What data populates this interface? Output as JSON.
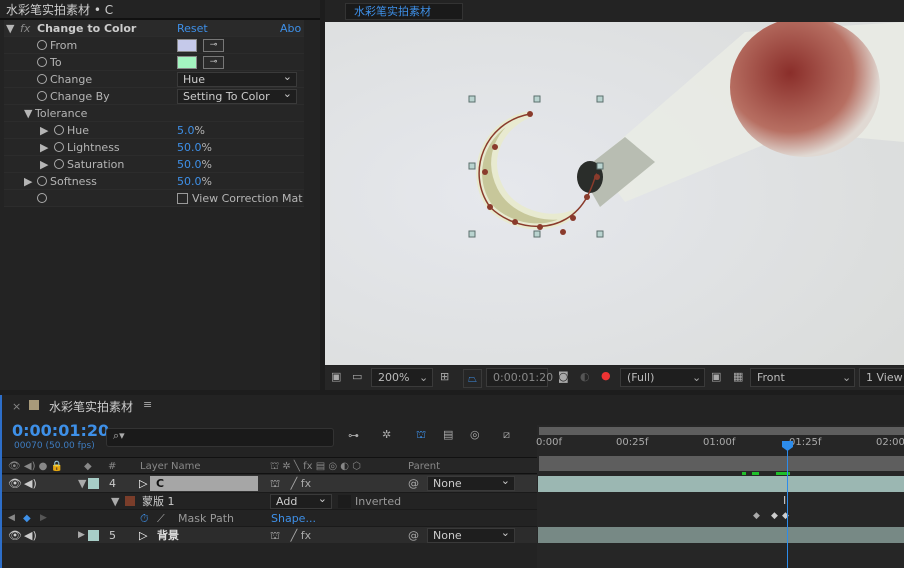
{
  "effects_panel": {
    "title": "水彩笔实拍素材 • C",
    "effect_name": "Change to Color",
    "reset": "Reset",
    "about": "Abo",
    "props": {
      "from": "From",
      "to": "To",
      "change": "Change",
      "change_value": "Hue",
      "change_by": "Change By",
      "change_by_value": "Setting To Color",
      "tolerance": "Tolerance",
      "hue": "Hue",
      "hue_value": "5.0",
      "lightness": "Lightness",
      "lightness_value": "50.0",
      "saturation": "Saturation",
      "saturation_value": "50.0",
      "softness": "Softness",
      "softness_value": "50.0",
      "percent": "%",
      "view_correction": "View Correction Mat"
    },
    "from_color": "#c5c9ea",
    "to_color": "#a3f4c0"
  },
  "viewer": {
    "tab": "水彩笔实拍素材",
    "zoom": "200%",
    "timecode": "0:00:01:20",
    "resolution": "(Full)",
    "view": "Front",
    "views": "1 View"
  },
  "timeline": {
    "tab": "水彩笔实拍素材",
    "timecode": "0:00:01:20",
    "frames": "00070 (50.00 fps)",
    "search_placeholder": "",
    "columns": {
      "num": "#",
      "layer_name": "Layer Name",
      "parent": "Parent"
    },
    "layers": [
      {
        "num": "4",
        "name": "C",
        "parent": "None",
        "color": "#a7cdc7"
      },
      {
        "num": "5",
        "name": "背景",
        "parent": "None",
        "color": "#a7cdc7"
      }
    ],
    "mask": {
      "name": "蒙版",
      "index": "1",
      "mode": "Add",
      "inverted": "Inverted",
      "color": "#7a3d2a",
      "path_label": "Mask Path",
      "path_value": "Shape..."
    },
    "ruler": [
      "0:00f",
      "00:25f",
      "01:00f",
      "01:25f",
      "02:00f"
    ],
    "accent": "#2d8ceb"
  }
}
